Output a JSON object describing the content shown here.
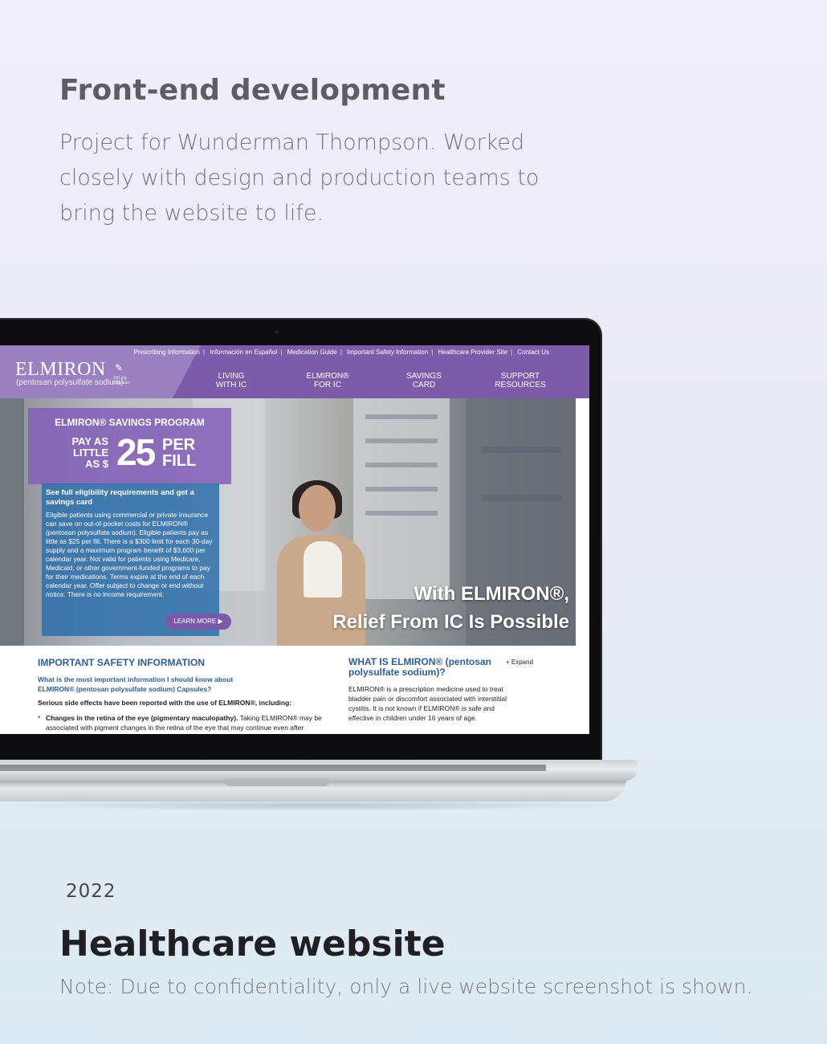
{
  "header": {
    "heading": "Front-end development",
    "intro": "Project for Wunderman Thompson. Worked closely with design and production teams to bring the website to life."
  },
  "footer": {
    "year": "2022",
    "title": "Healthcare website",
    "note": "Note: Due to confidentiality, only a live website screenshot is shown."
  },
  "site": {
    "top_links": [
      "Prescribing Information",
      "Información en Español",
      "Medication Guide",
      "Important Safety Information",
      "Healthcare Provider Site",
      "Contact Us"
    ],
    "logo": "ELMIRON",
    "logo_sub": "(pentosan polysulfate sodium)",
    "logo_dose": "100 mg Capsules",
    "nav": [
      {
        "line1": "LIVING",
        "line2": "WITH IC"
      },
      {
        "line1": "ELMIRON®",
        "line2": "FOR IC"
      },
      {
        "line1": "SAVINGS",
        "line2": "CARD"
      },
      {
        "line1": "SUPPORT",
        "line2": "RESOURCES"
      }
    ],
    "promo": {
      "title": "ELMIRON® SAVINGS PROGRAM",
      "pay1": "PAY AS",
      "pay2": "LITTLE",
      "pay3": "AS $",
      "amount": "25",
      "per": "PER",
      "fill": "FILL",
      "heading": "See full eligibility requirements and get a savings card",
      "body": "Eligible patients using commercial or private insurance can save on out-of-pocket costs for ELMIRON® (pentosan polysulfate sodium). Eligible patients pay as little as $25 per fill. There is a $300 limit for each 30-day supply and a maximum program benefit of $3,600 per calendar year. Not valid for patients using Medicare, Medicaid, or other government-funded programs to pay for their medications. Terms expire at the end of each calendar year. Offer subject to change or end without notice. There is no income requirement.",
      "cta": "LEARN MORE ▶"
    },
    "hero_line1": "With ELMIRON®,",
    "hero_line2": "Relief From IC Is Possible",
    "isi": {
      "heading": "IMPORTANT SAFETY INFORMATION",
      "question": "What is the most important information I should know about ELMIRON® (pentosan polysulfate sodium) Capsules?",
      "serious": "Serious side effects have been reported with the use of ELMIRON®, including:",
      "bullet_bold": "Changes in the retina of the eye (pigmentary maculopathy).",
      "bullet_text": " Taking ELMIRON® may be associated with pigment changes in the retina of the eye that may continue even after"
    },
    "what": {
      "heading": "WHAT IS ELMIRON® (pentosan polysulfate sodium)?",
      "expand": "+ Expand",
      "body": "ELMIRON® is a prescription medicine used to treat bladder pain or discomfort associated with interstitial cystitis. It is not known if ELMIRON® is safe and effective in children under 16 years of age."
    }
  }
}
